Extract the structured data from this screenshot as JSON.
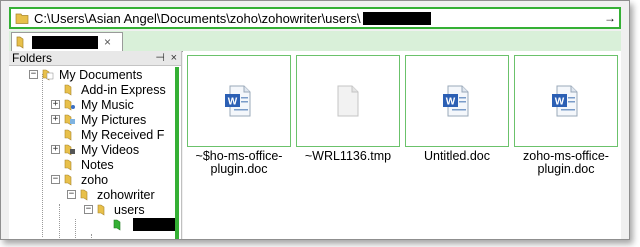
{
  "address_bar": {
    "path": "C:\\Users\\Asian Angel\\Documents\\zoho\\zohowriter\\users\\",
    "go_label": "→"
  },
  "tab": {
    "close_label": "×"
  },
  "folders_pane": {
    "title": "Folders",
    "pin_label": "ᴘ",
    "close_label": "×",
    "items": [
      {
        "label": "My Documents",
        "icon": "documents-folder-icon"
      },
      {
        "label": "Add-in Express",
        "icon": "folder-icon"
      },
      {
        "label": "My Music",
        "icon": "music-folder-icon"
      },
      {
        "label": "My Pictures",
        "icon": "pictures-folder-icon"
      },
      {
        "label": "My Received F",
        "icon": "folder-icon"
      },
      {
        "label": "My Videos",
        "icon": "videos-folder-icon"
      },
      {
        "label": "Notes",
        "icon": "folder-icon"
      },
      {
        "label": "zoho",
        "icon": "folder-icon"
      },
      {
        "label": "zohowriter",
        "icon": "folder-icon"
      },
      {
        "label": "users",
        "icon": "folder-icon"
      }
    ]
  },
  "files": [
    {
      "name": "~$ho-ms-office-plugin.doc",
      "icon": "word-document-icon"
    },
    {
      "name": "~WRL1136.tmp",
      "icon": "blank-file-icon"
    },
    {
      "name": "Untitled.doc",
      "icon": "word-document-icon"
    },
    {
      "name": "zoho-ms-office-plugin.doc",
      "icon": "word-document-icon"
    }
  ],
  "colors": {
    "accent": "#35b035",
    "folder": "#e8c04a"
  }
}
